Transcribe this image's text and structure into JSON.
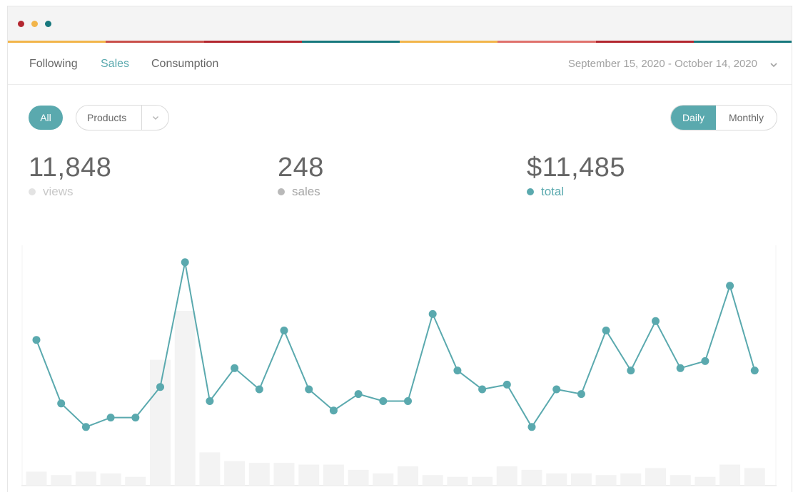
{
  "colors": {
    "accent": "#5aa9ae",
    "stripe": [
      "#f2b54a",
      "#c94f4a",
      "#b3262f",
      "#17787d",
      "#f2b54a",
      "#e0716c",
      "#b3262f",
      "#17787d"
    ]
  },
  "nav": {
    "tabs": [
      {
        "label": "Following",
        "active": false
      },
      {
        "label": "Sales",
        "active": true
      },
      {
        "label": "Consumption",
        "active": false
      }
    ],
    "date_range": "September 15, 2020 - October 14, 2020"
  },
  "filters": {
    "all_label": "All",
    "products_label": "Products",
    "period": {
      "daily": "Daily",
      "monthly": "Monthly",
      "selected": "Daily"
    }
  },
  "stats": [
    {
      "value": "11,848",
      "label": "views",
      "dot_color": "#e3e3e3",
      "label_color": "#c8c8c8"
    },
    {
      "value": "248",
      "label": "sales",
      "dot_color": "#b9b9b9",
      "label_color": "#a6a6a6"
    },
    {
      "value": "$11,485",
      "label": "total",
      "dot_color": "#5aa9ae",
      "label_color": "#5aa9ae"
    }
  ],
  "chart_data": {
    "type": "line",
    "grid": false,
    "x": [
      1,
      2,
      3,
      4,
      5,
      6,
      7,
      8,
      9,
      10,
      11,
      12,
      13,
      14,
      15,
      16,
      17,
      18,
      19,
      20,
      21,
      22,
      23,
      24,
      25,
      26,
      27,
      28,
      29,
      30
    ],
    "series": [
      {
        "type": "line",
        "values": [
          61,
          34,
          24,
          28,
          28,
          41,
          94,
          35,
          49,
          40,
          65,
          40,
          31,
          38,
          35,
          35,
          72,
          48,
          40,
          42,
          24,
          40,
          38,
          65,
          48,
          69,
          49,
          52,
          84,
          48
        ]
      },
      {
        "type": "bar",
        "values": [
          8,
          6,
          8,
          7,
          5,
          72,
          100,
          19,
          14,
          13,
          13,
          12,
          12,
          9,
          7,
          11,
          6,
          5,
          5,
          11,
          9,
          7,
          7,
          6,
          7,
          10,
          6,
          5,
          12,
          10
        ]
      }
    ]
  }
}
